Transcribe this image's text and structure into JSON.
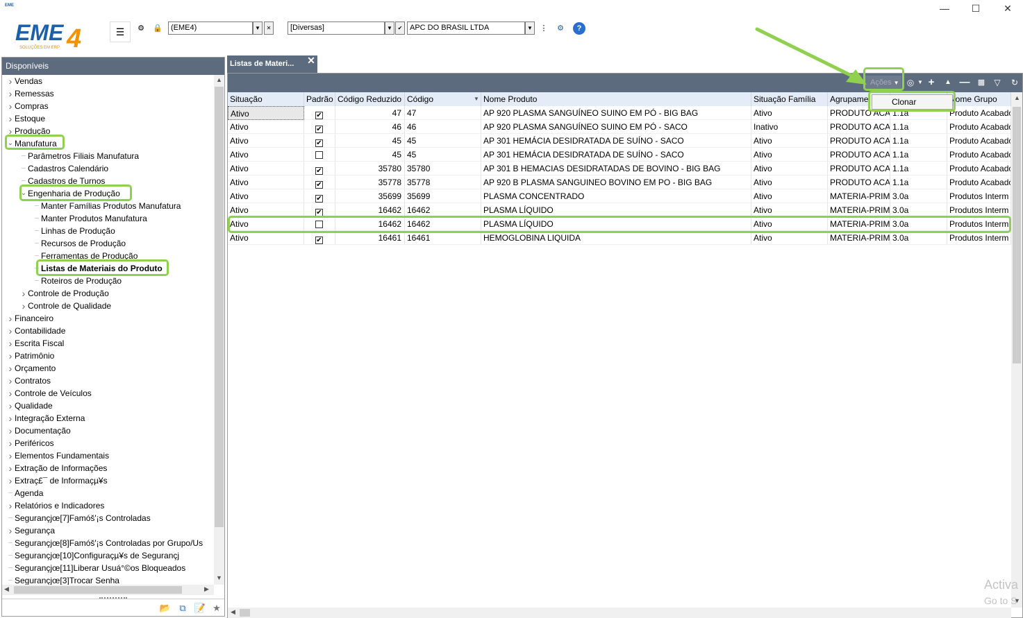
{
  "app": {
    "window_icon": "eme4-app-icon",
    "logo_text": "EME4",
    "logo_tagline": "SOLUÇÕES EM ERP"
  },
  "toolbar": {
    "company_combo": "(EME4)",
    "branch_combo": "[Diversas]",
    "firm_combo": "APC DO BRASIL LTDA"
  },
  "left_panel": {
    "header": "Disponíveis",
    "tree": [
      {
        "label": "Vendas",
        "level": 0,
        "expander": "collapsed"
      },
      {
        "label": "Remessas",
        "level": 0,
        "expander": "collapsed"
      },
      {
        "label": "Compras",
        "level": 0,
        "expander": "collapsed"
      },
      {
        "label": "Estoque",
        "level": 0,
        "expander": "collapsed"
      },
      {
        "label": "Produção",
        "level": 0,
        "expander": "collapsed"
      },
      {
        "label": "Manufatura",
        "level": 0,
        "expander": "expanded"
      },
      {
        "label": "Parâmetros Filiais Manufatura",
        "level": 1,
        "expander": "none"
      },
      {
        "label": "Cadastros Calendário",
        "level": 1,
        "expander": "none"
      },
      {
        "label": "Cadastros de Turnos",
        "level": 1,
        "expander": "none"
      },
      {
        "label": "Engenharia de Produção",
        "level": 1,
        "expander": "expanded"
      },
      {
        "label": "Manter Famílias Produtos Manufatura",
        "level": 2,
        "expander": "none"
      },
      {
        "label": "Manter Produtos Manufatura",
        "level": 2,
        "expander": "none"
      },
      {
        "label": "Linhas de Produção",
        "level": 2,
        "expander": "none"
      },
      {
        "label": "Recursos de Produção",
        "level": 2,
        "expander": "none"
      },
      {
        "label": "Ferramentas de Produção",
        "level": 2,
        "expander": "none"
      },
      {
        "label": "Listas de Materiais do Produto",
        "level": 2,
        "expander": "none",
        "selected": true
      },
      {
        "label": "Roteiros de Produção",
        "level": 2,
        "expander": "none"
      },
      {
        "label": "Controle de Produção",
        "level": 1,
        "expander": "collapsed"
      },
      {
        "label": "Controle de Qualidade",
        "level": 1,
        "expander": "collapsed"
      },
      {
        "label": "Financeiro",
        "level": 0,
        "expander": "collapsed"
      },
      {
        "label": "Contabilidade",
        "level": 0,
        "expander": "collapsed"
      },
      {
        "label": "Escrita Fiscal",
        "level": 0,
        "expander": "collapsed"
      },
      {
        "label": "Patrimônio",
        "level": 0,
        "expander": "collapsed"
      },
      {
        "label": "Orçamento",
        "level": 0,
        "expander": "collapsed"
      },
      {
        "label": "Contratos",
        "level": 0,
        "expander": "collapsed"
      },
      {
        "label": "Controle de Veículos",
        "level": 0,
        "expander": "collapsed"
      },
      {
        "label": "Qualidade",
        "level": 0,
        "expander": "collapsed"
      },
      {
        "label": "Integração Externa",
        "level": 0,
        "expander": "collapsed"
      },
      {
        "label": "Documentação",
        "level": 0,
        "expander": "collapsed"
      },
      {
        "label": "Periféricos",
        "level": 0,
        "expander": "collapsed"
      },
      {
        "label": "Elementos Fundamentais",
        "level": 0,
        "expander": "collapsed"
      },
      {
        "label": "Extração de Informações",
        "level": 0,
        "expander": "collapsed"
      },
      {
        "label": "Extraç£¯ de Informaçµ¥s",
        "level": 0,
        "expander": "collapsed"
      },
      {
        "label": "Agenda",
        "level": 0,
        "expander": "none"
      },
      {
        "label": "Relatórios e Indicadores",
        "level": 0,
        "expander": "collapsed"
      },
      {
        "label": "Segurançjœ[7]Famóš'¡s Controladas",
        "level": 0,
        "expander": "none"
      },
      {
        "label": "Segurança",
        "level": 0,
        "expander": "collapsed"
      },
      {
        "label": "Segurançjœ[8]Famóš'¡s Controladas por Grupo/Us",
        "level": 0,
        "expander": "none"
      },
      {
        "label": "Segurançjœ[10]Configuraçµ¥s de Segurançj",
        "level": 0,
        "expander": "none"
      },
      {
        "label": "Segurançjœ[11]Liberar Usuá°©os Bloqueados",
        "level": 0,
        "expander": "none"
      },
      {
        "label": "Segurançjœ[3]Trocar Senha",
        "level": 0,
        "expander": "none"
      }
    ]
  },
  "tab": {
    "label": "Listas de Materi..."
  },
  "grid_toolbar": {
    "acoes_label": "Ações"
  },
  "context_menu": {
    "items": [
      "Clonar"
    ]
  },
  "grid": {
    "columns": [
      "Situação",
      "Padrão",
      "Código Reduzido",
      "Código",
      "Nome Produto",
      "Situação Família",
      "Agrupame",
      "",
      "Nome Grupo"
    ],
    "rows": [
      {
        "situacao": "Ativo",
        "padrao": true,
        "codred": "47",
        "codigo": "47",
        "nome": "AP 920 PLASMA SANGUÍNEO SUINO EM PÓ - BIG BAG",
        "sitfam": "Ativo",
        "agrup": "PRODUTO ACA",
        "ver": "1.1a",
        "grupo": "Produto Acabado"
      },
      {
        "situacao": "Ativo",
        "padrao": true,
        "codred": "46",
        "codigo": "46",
        "nome": "AP 920 PLASMA SANGUÍNEO SUINO EM PÓ - SACO",
        "sitfam": "Inativo",
        "agrup": "PRODUTO ACA",
        "ver": "1.1a",
        "grupo": "Produto Acabado"
      },
      {
        "situacao": "Ativo",
        "padrao": true,
        "codred": "45",
        "codigo": "45",
        "nome": "AP 301 HEMÁCIA DESIDRATADA DE SUÍNO -  SACO",
        "sitfam": "Ativo",
        "agrup": "PRODUTO ACA",
        "ver": "1.1a",
        "grupo": "Produto Acabado"
      },
      {
        "situacao": "Ativo",
        "padrao": false,
        "codred": "45",
        "codigo": "45",
        "nome": "AP 301 HEMÁCIA DESIDRATADA DE SUÍNO -  SACO",
        "sitfam": "Ativo",
        "agrup": "PRODUTO ACA",
        "ver": "1.1a",
        "grupo": "Produto Acabado"
      },
      {
        "situacao": "Ativo",
        "padrao": true,
        "codred": "35780",
        "codigo": "35780",
        "nome": "AP 301 B HEMACIAS DESIDRATADAS DE BOVINO - BIG BAG",
        "sitfam": "Ativo",
        "agrup": "PRODUTO ACA",
        "ver": "1.1a",
        "grupo": "Produto Acabado"
      },
      {
        "situacao": "Ativo",
        "padrao": true,
        "codred": "35778",
        "codigo": "35778",
        "nome": "AP 920 B PLASMA SANGUINEO BOVINO EM PO - BIG BAG",
        "sitfam": "Ativo",
        "agrup": "PRODUTO ACA",
        "ver": "1.1a",
        "grupo": "Produto Acabado"
      },
      {
        "situacao": "Ativo",
        "padrao": true,
        "codred": "35699",
        "codigo": "35699",
        "nome": "PLASMA CONCENTRADO",
        "sitfam": "Ativo",
        "agrup": "MATERIA-PRIM",
        "ver": "3.0a",
        "grupo": "Produtos Interm"
      },
      {
        "situacao": "Ativo",
        "padrao": true,
        "codred": "16462",
        "codigo": "16462",
        "nome": "PLASMA LÍQUIDO",
        "sitfam": "Ativo",
        "agrup": "MATERIA-PRIM",
        "ver": "3.0a",
        "grupo": "Produtos Interm"
      },
      {
        "situacao": "Ativo",
        "padrao": false,
        "codred": "16462",
        "codigo": "16462",
        "nome": "PLASMA LÍQUIDO",
        "sitfam": "Ativo",
        "agrup": "MATERIA-PRIM",
        "ver": "3.0a",
        "grupo": "Produtos Interm"
      },
      {
        "situacao": "Ativo",
        "padrao": true,
        "codred": "16461",
        "codigo": "16461",
        "nome": "HEMOGLOBINA LIQUIDA",
        "sitfam": "Ativo",
        "agrup": "MATERIA-PRIM",
        "ver": "3.0a",
        "grupo": "Produtos Interm"
      }
    ]
  },
  "watermark": {
    "line1": "Activa",
    "line2": "Go to S"
  },
  "colors": {
    "panel_header": "#5d6b7f",
    "grid_header": "#e3ecf7",
    "highlight": "#8fd14f",
    "logo_blue": "#1d5fa8",
    "logo_orange": "#f39200"
  }
}
